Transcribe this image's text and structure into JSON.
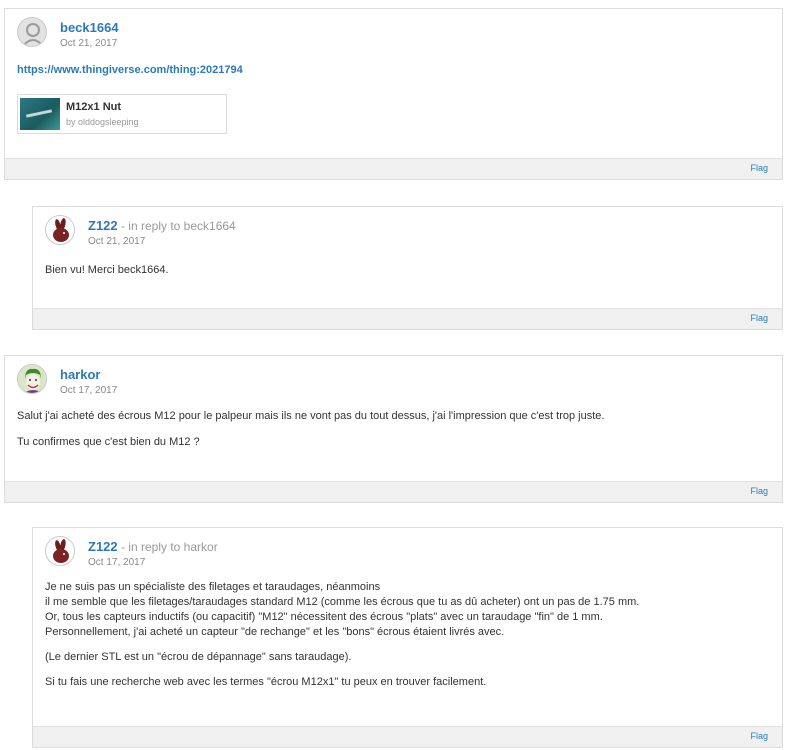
{
  "comments": [
    {
      "author": "beck1664",
      "date": "Oct 21, 2017",
      "link": "https://www.thingiverse.com/thing:2021794",
      "thing": {
        "title": "M12x1 Nut",
        "by": "by olddogsleeping"
      },
      "flag": "Flag"
    },
    {
      "author": "Z122",
      "reply_prefix": " - in reply to ",
      "reply_to": "beck1664",
      "date": "Oct 21, 2017",
      "text": [
        "Bien vu! Merci beck1664."
      ],
      "flag": "Flag"
    },
    {
      "author": "harkor",
      "date": "Oct 17, 2017",
      "text": [
        "Salut j'ai acheté des écrous M12 pour le palpeur mais ils ne vont pas du tout dessus, j'ai l'impression que c'est trop juste.",
        "Tu confirmes que c'est bien du M12 ?"
      ],
      "flag": "Flag"
    },
    {
      "author": "Z122",
      "reply_prefix": " - in reply to ",
      "reply_to": "harkor",
      "date": "Oct 17, 2017",
      "text": [
        "Je ne suis pas un spécialiste des filetages et taraudages, néanmoins",
        "il me semble que les filetages/taraudages standard M12 (comme les écrous que tu as dû acheter) ont un pas de 1.75 mm.",
        "Or, tous les capteurs inductifs (ou capacitif) \"M12\" nécessitent des écrous \"plats\" avec un taraudage \"fin\" de 1 mm.",
        "Personnellement, j'ai acheté un capteur \"de rechange\" et les \"bons\" écrous étaient livrés avec.",
        "(Le dernier STL est un \"écrou de dépannage\" sans taraudage).",
        "Si tu fais une recherche web avec les termes \"écrou M12x1\" tu peux en trouver facilement."
      ],
      "flag": "Flag"
    }
  ]
}
